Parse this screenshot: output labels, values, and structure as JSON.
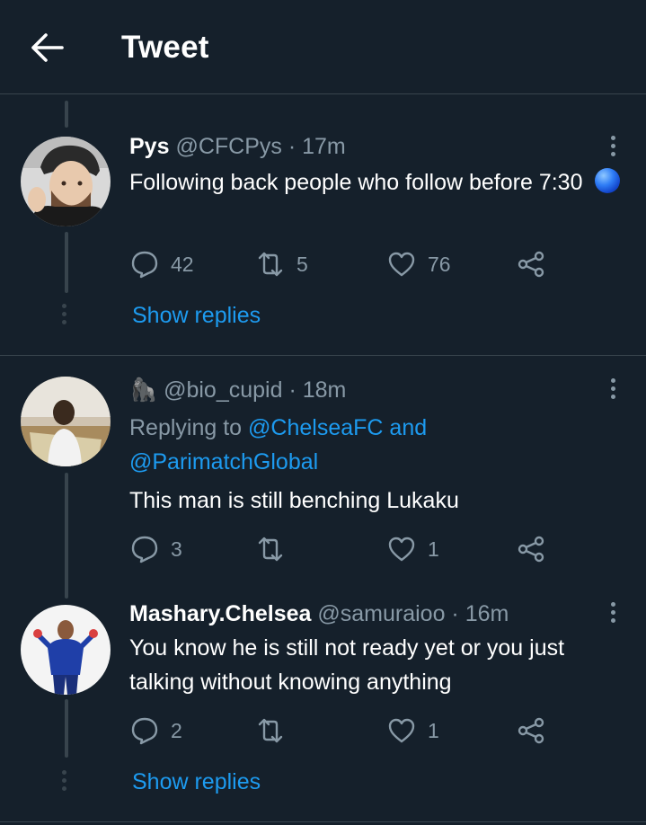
{
  "header": {
    "title": "Tweet"
  },
  "tweets": [
    {
      "name": "Pys",
      "handle": "@CFCPys",
      "sep": " · ",
      "time": "17m",
      "text": "Following back people who follow before 7:30",
      "emoji": "blue-circle",
      "replies": "42",
      "retweets": "5",
      "likes": "76"
    },
    {
      "name_emoji": "🦍",
      "handle": "@bio_cupid",
      "sep": " · ",
      "time": "18m",
      "replying_prefix": "Replying to ",
      "mention1": "@ChelseaFC",
      "and": " and",
      "mention2": "@ParimatchGlobal",
      "text": "This man is still benching Lukaku",
      "replies": "3",
      "retweets": "",
      "likes": "1"
    },
    {
      "name": "Mashary.Chelsea",
      "handle": "@samuraioo",
      "sep": " · ",
      "time": "16m",
      "text": "You know he is still not ready yet or you just talking without knowing anything",
      "replies": "2",
      "retweets": "",
      "likes": "1"
    }
  ],
  "show_replies_label": "Show replies",
  "colors": {
    "background": "#15202b",
    "accent": "#1d9bf0",
    "muted": "#8899a6",
    "divider": "#38444d"
  }
}
